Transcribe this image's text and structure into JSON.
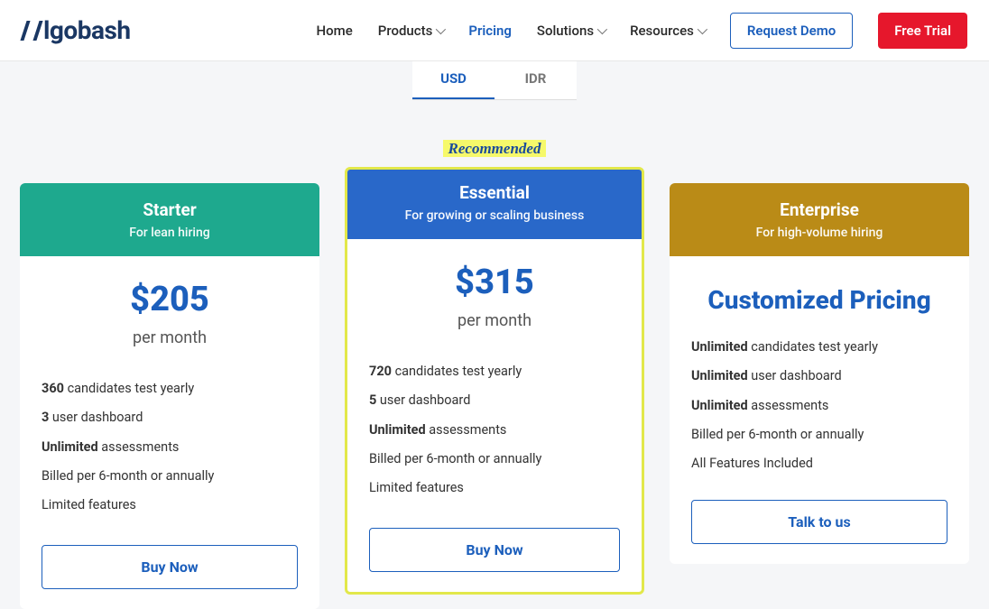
{
  "logo_text": "lgobash",
  "nav": {
    "home": "Home",
    "products": "Products",
    "pricing": "Pricing",
    "solutions": "Solutions",
    "resources": "Resources",
    "request_demo": "Request Demo",
    "free_trial": "Free Trial"
  },
  "currency": {
    "usd": "USD",
    "idr": "IDR"
  },
  "recommended": "Recommended",
  "plans": {
    "starter": {
      "title": "Starter",
      "sub": "For lean hiring",
      "price": "$205",
      "period": "per month",
      "f1_b": "360",
      "f1_t": " candidates test yearly",
      "f2_b": "3",
      "f2_t": " user dashboard",
      "f3_b": "Unlimited",
      "f3_t": " assessments",
      "f4": "Billed per 6-month or annually",
      "f5": "Limited features",
      "cta": "Buy Now"
    },
    "essential": {
      "title": "Essential",
      "sub": "For growing or scaling business",
      "price": "$315",
      "period": "per month",
      "f1_b": "720",
      "f1_t": " candidates test yearly",
      "f2_b": "5",
      "f2_t": " user dashboard",
      "f3_b": "Unlimited",
      "f3_t": " assessments",
      "f4": "Billed per 6-month or annually",
      "f5": "Limited features",
      "cta": "Buy Now"
    },
    "enterprise": {
      "title": "Enterprise",
      "sub": "For high-volume hiring",
      "custom": "Customized Pricing",
      "f1_b": "Unlimited",
      "f1_t": " candidates test yearly",
      "f2_b": "Unlimited",
      "f2_t": " user dashboard",
      "f3_b": "Unlimited",
      "f3_t": " assessments",
      "f4": "Billed per 6-month or annually",
      "f5": "All Features Included",
      "cta": "Talk to us"
    }
  }
}
